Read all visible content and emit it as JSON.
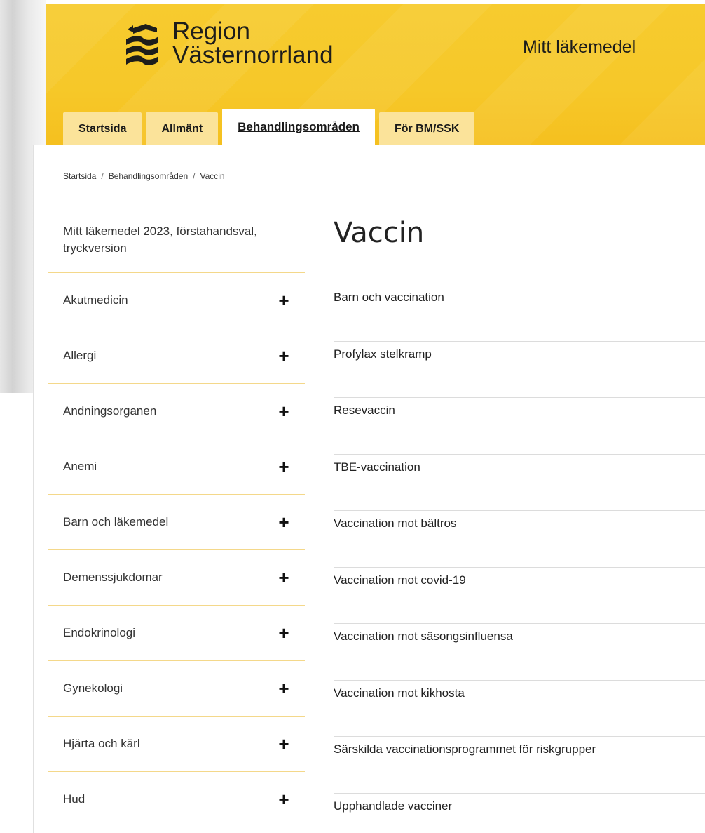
{
  "header": {
    "logo_line1": "Region",
    "logo_line2": "Västernorrland",
    "site_name": "Mitt läkemedel",
    "brand_color": "#f6c92e"
  },
  "tabs": [
    {
      "label": "Startsida",
      "active": false
    },
    {
      "label": "Allmänt",
      "active": false
    },
    {
      "label": "Behandlingsområden",
      "active": true
    },
    {
      "label": "För BM/SSK",
      "active": false
    }
  ],
  "breadcrumb": {
    "items": [
      "Startsida",
      "Behandlingsområden",
      "Vaccin"
    ],
    "separator": "/"
  },
  "sidebar": {
    "top_link": "Mitt läkemedel 2023, förstahandsval, tryckversion",
    "expand_symbol": "+",
    "items": [
      {
        "label": "Akutmedicin"
      },
      {
        "label": "Allergi"
      },
      {
        "label": "Andningsorganen"
      },
      {
        "label": "Anemi"
      },
      {
        "label": "Barn och läkemedel"
      },
      {
        "label": "Demenssjukdomar"
      },
      {
        "label": "Endokrinologi"
      },
      {
        "label": "Gynekologi"
      },
      {
        "label": "Hjärta och kärl"
      },
      {
        "label": "Hud"
      }
    ]
  },
  "main": {
    "title": "Vaccin",
    "links": [
      "Barn och vaccination",
      "Profylax stelkramp",
      "Resevaccin",
      "TBE-vaccination",
      "Vaccination mot bältros",
      "Vaccination mot covid-19",
      "Vaccination mot säsongsinfluensa",
      "Vaccination mot kikhosta",
      "Särskilda vaccinationsprogrammet för riskgrupper",
      "Upphandlade vacciner"
    ]
  }
}
